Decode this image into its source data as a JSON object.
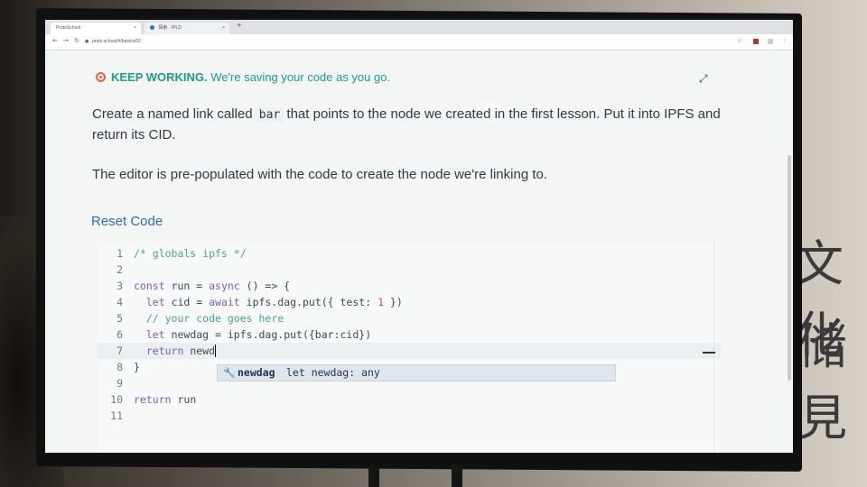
{
  "browser": {
    "tabs": [
      {
        "label": "ProtoSchool"
      },
      {
        "label": "探索 · IPLD"
      }
    ],
    "url": "proto.school/#/basics/02"
  },
  "banner": {
    "strong": "KEEP WORKING.",
    "rest": " We're saving your code as you go."
  },
  "instructions": {
    "p1_before": "Create a named link called ",
    "p1_code": "bar",
    "p1_after": " that points to the node we created in the first lesson. Put it into IPFS and return its CID.",
    "p2": "The editor is pre-populated with the code to create the node we're linking to."
  },
  "reset_label": "Reset Code",
  "editor": {
    "lines": [
      {
        "n": "1",
        "text": "/* globals ipfs */"
      },
      {
        "n": "2",
        "text": ""
      },
      {
        "n": "3",
        "text": "const run = async () => {"
      },
      {
        "n": "4",
        "text": "  let cid = await ipfs.dag.put({ test: 1 })"
      },
      {
        "n": "5",
        "text": "  // your code goes here"
      },
      {
        "n": "6",
        "text": "  let newdag = ipfs.dag.put({bar:cid})"
      },
      {
        "n": "7",
        "text": "  return newd"
      },
      {
        "n": "8",
        "text": "}"
      },
      {
        "n": "9",
        "text": ""
      },
      {
        "n": "10",
        "text": "return run"
      },
      {
        "n": "11",
        "text": ""
      }
    ],
    "suggestion": {
      "label": "newdag",
      "detail": "let newdag: any"
    }
  },
  "wall_text": {
    "line1": "文化",
    "line2": "储見"
  },
  "colors": {
    "accent_teal": "#1c9a8a",
    "link_blue": "#2f6da6",
    "warning_orange": "#e8633a"
  }
}
